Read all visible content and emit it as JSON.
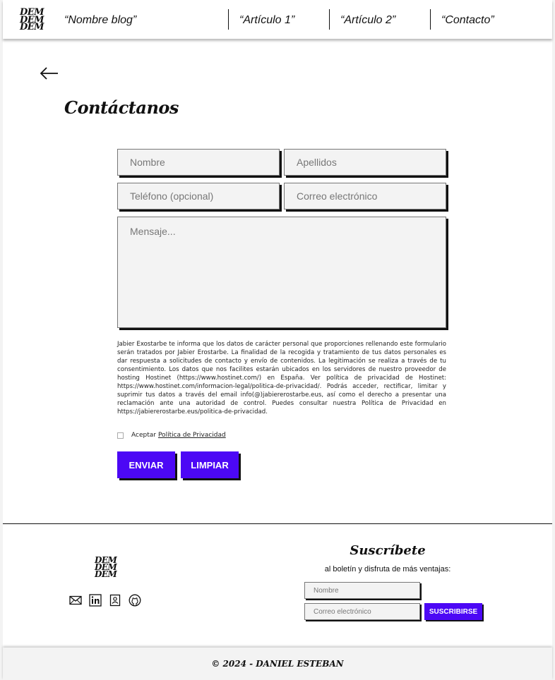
{
  "header": {
    "logo_lines": [
      "DEM",
      "DEM",
      "DEM"
    ],
    "nav": [
      "“Nombre blog”",
      "“Artículo 1”",
      "“Artículo 2”",
      "“Contacto”"
    ]
  },
  "contact": {
    "title": "Contáctanos",
    "fields": {
      "nombre": "Nombre",
      "apellidos": "Apellidos",
      "telefono": "Teléfono (opcional)",
      "correo": "Correo electrónico",
      "mensaje": "Mensaje..."
    },
    "legal_text": "Jabier Exostarbe te informa que los datos de carácter personal que proporciones rellenando este formulario serán tratados por Jabier Erostarbe. La finalidad de la recogida y tratamiento de tus datos personales es dar respuesta a solicitudes de contacto y envío de contenidos. La legitimación se realiza a través de tu consentimiento. Los datos que nos facilites estarán ubicados en los servidores de nuestro proveedor de hosting Hostinet (https://www.hostinet.com/) en España. Ver política de privacidad de Hostinet: https://www.hostinet.com/informacion-legal/politica-de-privacidad/. Podrás acceder, rectificar, limitar y suprimir tus datos a través del email info(@)jabiererostarbe.eus, así como el derecho a presentar una reclamación ante una autoridad de control. Puedes consultar nuestra Política de Privacidad en https://jabiererostarbe.eus/politica-de-privacidad.",
    "consent_prefix": "Aceptar",
    "consent_link": "Política de Privacidad",
    "send_label": "ENVIAR",
    "clear_label": "LIMPIAR"
  },
  "footer": {
    "logo_lines": [
      "DEM",
      "DEM",
      "DEM"
    ],
    "social_icons": [
      "mail-icon",
      "linkedin-icon",
      "contact-card-icon",
      "github-icon"
    ],
    "subscribe_title": "Suscríbete",
    "subscribe_desc": "al boletín y disfruta de más ventajas:",
    "name_placeholder": "Nombre",
    "email_placeholder": "Correo electrónico",
    "subscribe_button": "SUSCRIBIRSE",
    "copyright": "© 2024 - DANIEL ESTEBAN"
  },
  "colors": {
    "accent": "#4c08f5",
    "field_bg": "#f3f3f3"
  }
}
